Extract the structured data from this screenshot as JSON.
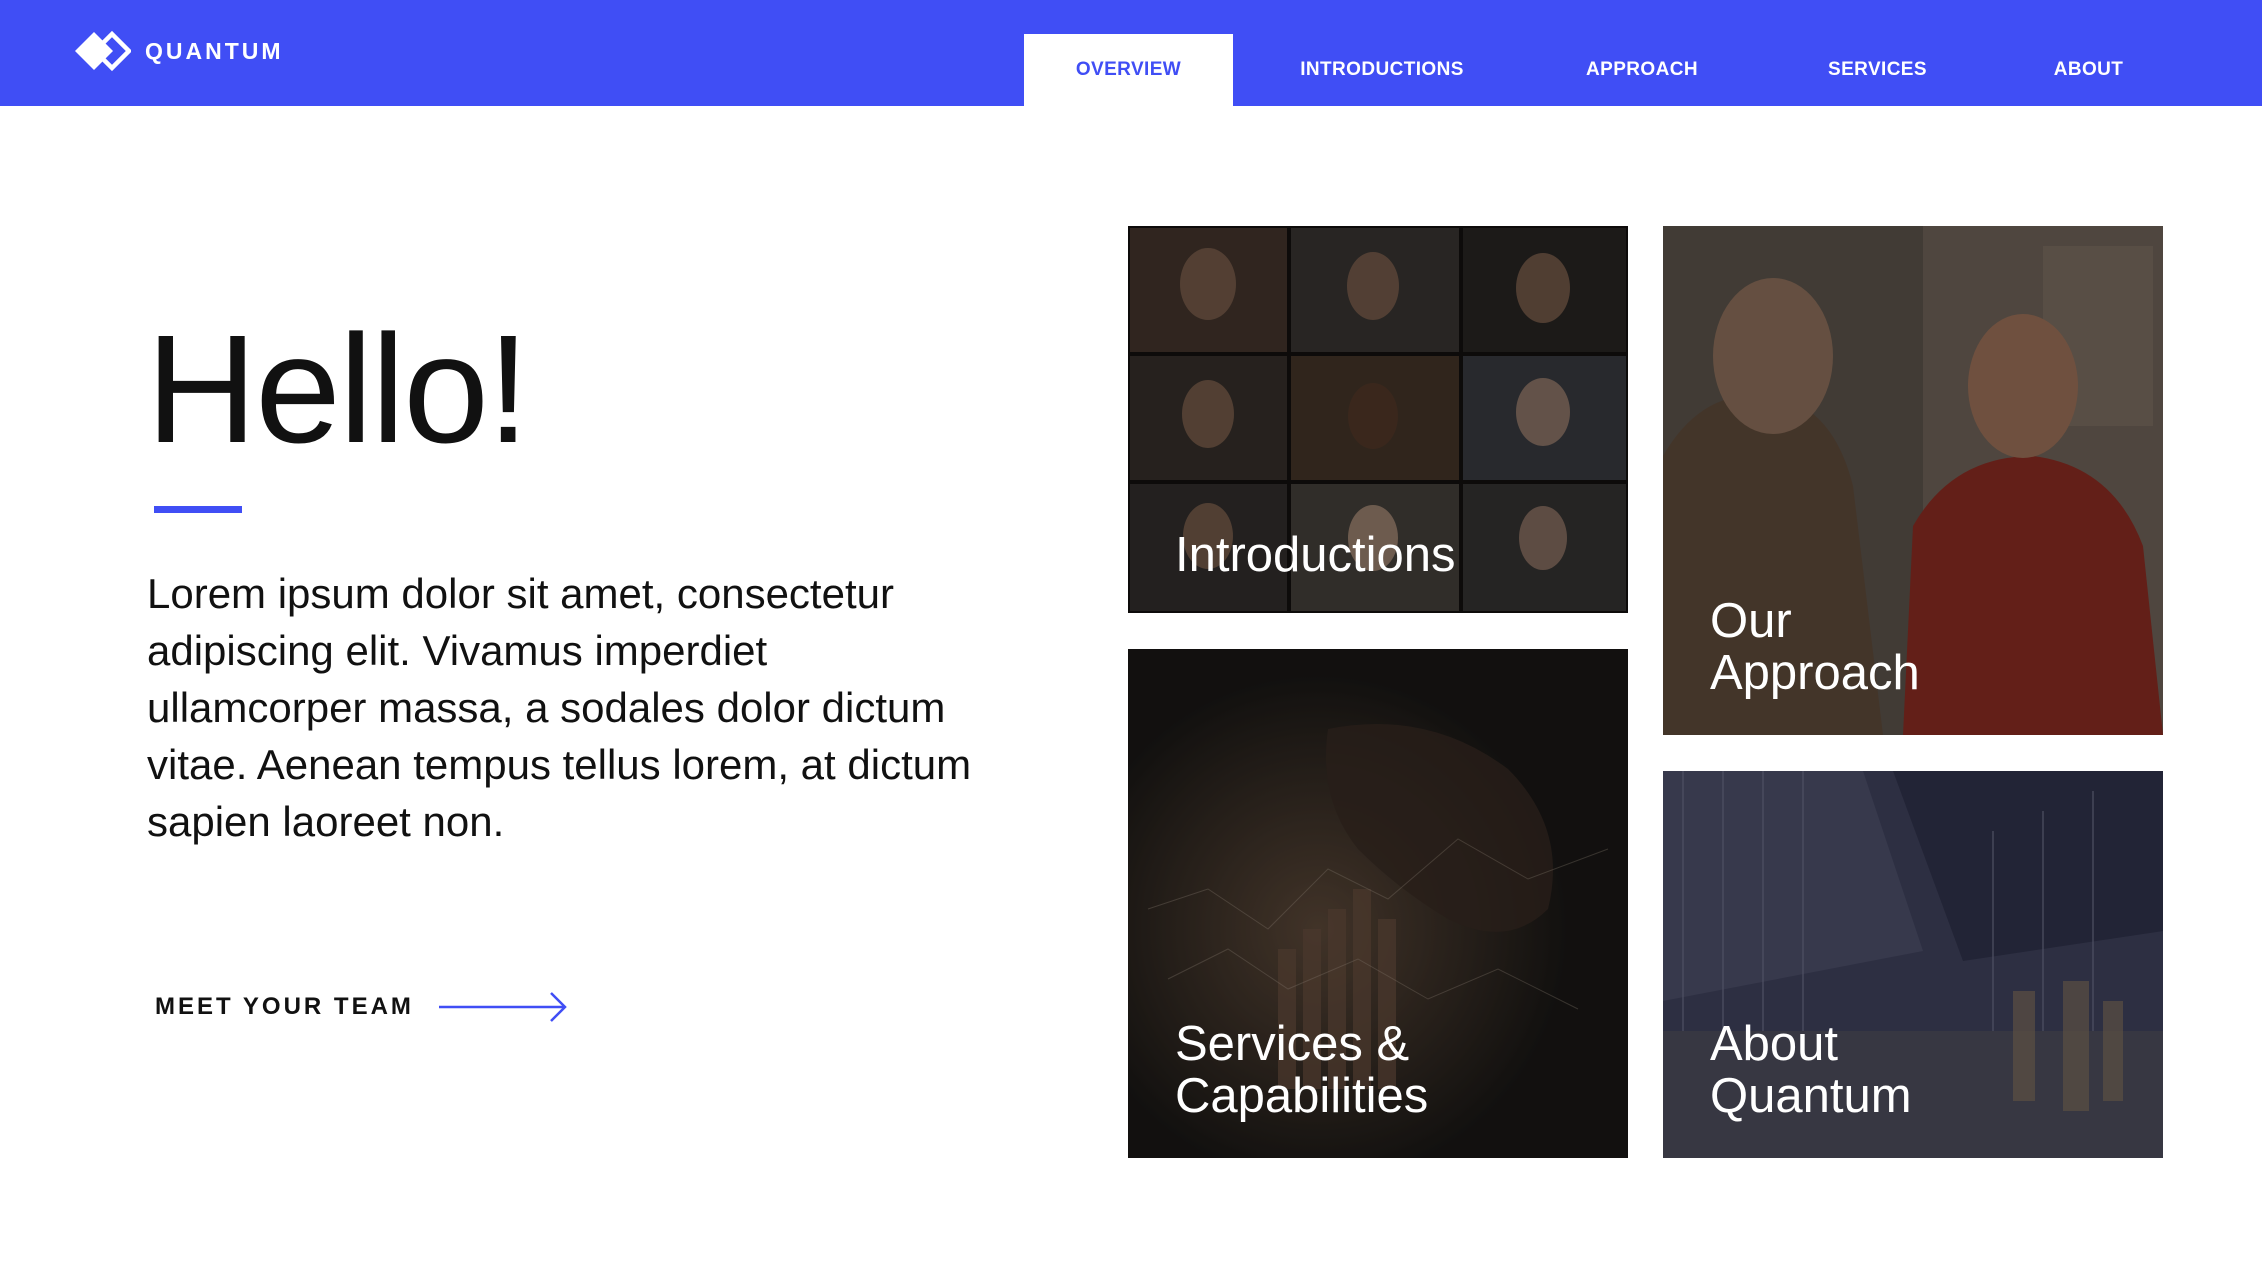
{
  "brand": {
    "name": "QUANTUM",
    "accent": "#404ef5"
  },
  "nav": {
    "items": [
      {
        "label": "OVERVIEW",
        "active": true
      },
      {
        "label": "INTRODUCTIONS",
        "active": false
      },
      {
        "label": "APPROACH",
        "active": false
      },
      {
        "label": "SERVICES",
        "active": false
      },
      {
        "label": "ABOUT",
        "active": false
      }
    ]
  },
  "hero": {
    "title": "Hello!",
    "body": "Lorem ipsum dolor sit amet, consectetur adipiscing elit. Vivamus imperdiet ullamcorper massa, a sodales dolor dictum vitae. Aenean tempus tellus lorem, at dictum sapien laoreet non.",
    "cta_label": "MEET YOUR TEAM",
    "cta_icon": "arrow-right-icon"
  },
  "tiles": [
    {
      "label": "Introductions",
      "image": "video-call-grid-photo"
    },
    {
      "label": "Our\nApproach",
      "image": "two-men-talking-photo"
    },
    {
      "label": "Services &\nCapabilities",
      "image": "hand-touching-chart-photo"
    },
    {
      "label": "About\nQuantum",
      "image": "city-street-photo"
    }
  ]
}
